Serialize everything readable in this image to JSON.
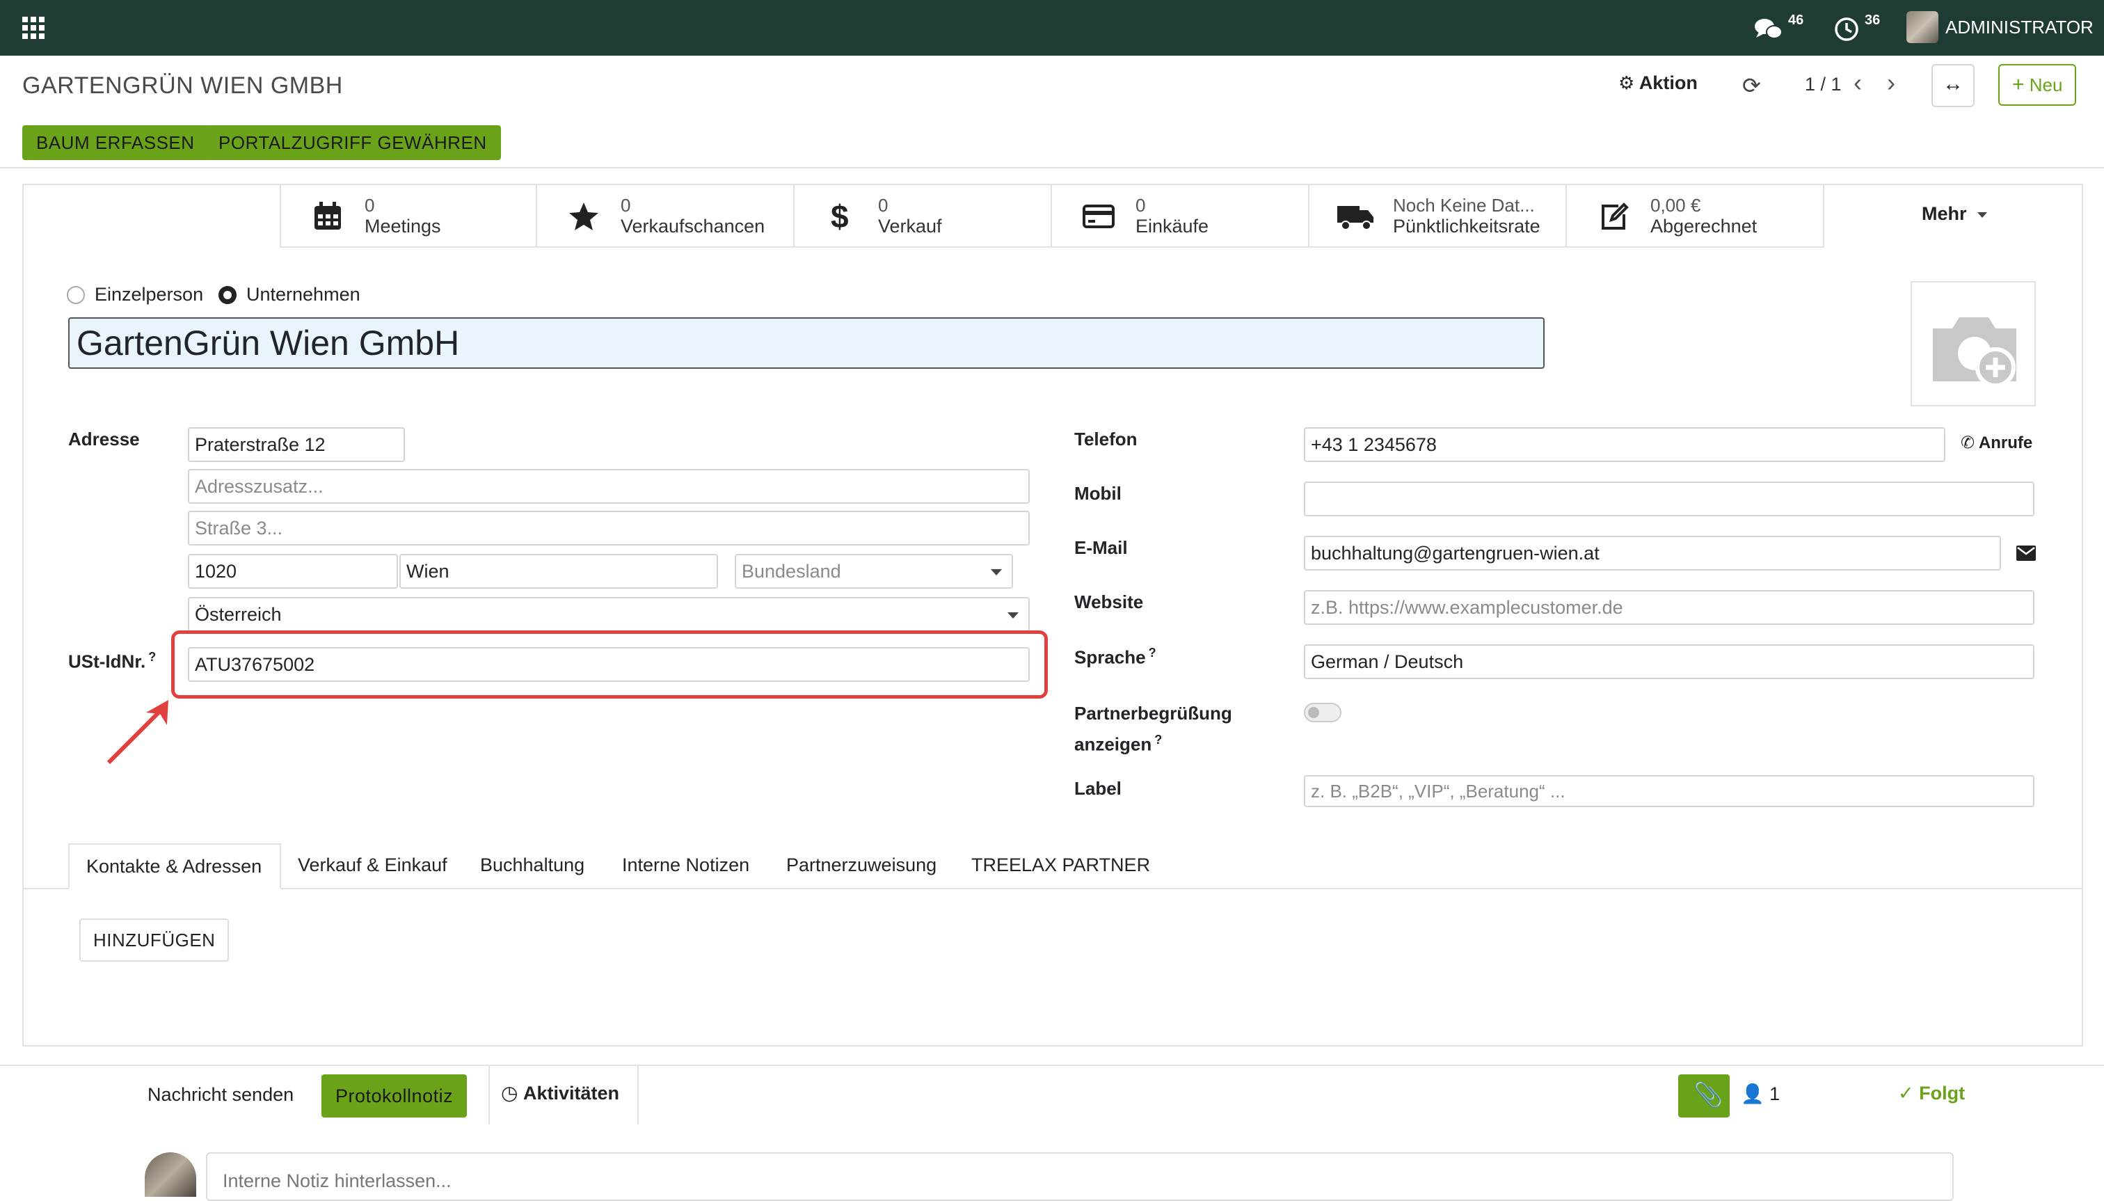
{
  "topbar": {
    "messages_count": "46",
    "activities_count": "36",
    "user_name": "ADMINISTRATOR",
    "bg_color": "#1f3b36"
  },
  "control": {
    "title": "GARTENGRÜN WIEN GMBH",
    "action_label": "Aktion",
    "pager": "1 / 1",
    "new_label": "Neu",
    "btn_tree": "BAUM ERFASSEN",
    "btn_portal": "PORTALZUGRIFF GEWÄHREN"
  },
  "stats": [
    {
      "value": "0",
      "label": "Meetings",
      "icon": "calendar-icon"
    },
    {
      "value": "0",
      "label": "Verkaufschancen",
      "icon": "star-icon"
    },
    {
      "value": "0",
      "label": "Verkauf",
      "icon": "dollar-icon"
    },
    {
      "value": "0",
      "label": "Einkäufe",
      "icon": "credit-card-icon"
    },
    {
      "value": "Noch Keine Dat...",
      "label": "Pünktlichkeitsrate",
      "icon": "truck-icon"
    },
    {
      "value": "0,00 €",
      "label": "Abgerechnet",
      "icon": "edit-icon"
    }
  ],
  "more_label": "Mehr",
  "company_type": {
    "individual": "Einzelperson",
    "company": "Unternehmen",
    "selected": "company"
  },
  "name": "GartenGrün Wien GmbH",
  "address": {
    "label": "Adresse",
    "street": "Praterstraße 12",
    "street2_placeholder": "Adresszusatz...",
    "street3_placeholder": "Straße 3...",
    "zip": "1020",
    "city": "Wien",
    "state_placeholder": "Bundesland",
    "country": "Österreich"
  },
  "vat": {
    "label": "USt-IdNr.",
    "value": "ATU37675002",
    "highlight_color": "#e0413f"
  },
  "right_fields": {
    "phone_label": "Telefon",
    "phone": "+43 1 2345678",
    "call_label": "Anrufe",
    "mobile_label": "Mobil",
    "mobile": "",
    "email_label": "E-Mail",
    "email": "buchhaltung@gartengruen-wien.at",
    "website_label": "Website",
    "website_placeholder": "z.B. https://www.examplecustomer.de",
    "language_label": "Sprache",
    "language": "German / Deutsch",
    "greeting_label_1": "Partnerbegrüßung",
    "greeting_label_2": "anzeigen",
    "tag_label": "Label",
    "tag_placeholder": "z. B. „B2B“, „VIP“, „Beratung“ ..."
  },
  "tabs": [
    "Kontakte & Adressen",
    "Verkauf & Einkauf",
    "Buchhaltung",
    "Interne Notizen",
    "Partnerzuweisung",
    "TREELAX PARTNER"
  ],
  "add_button": "HINZUFÜGEN",
  "chatter": {
    "send_message": "Nachricht senden",
    "log_note": "Protokollnotiz",
    "activities": "Aktivitäten",
    "followers_count": "1",
    "following": "Folgt",
    "note_placeholder": "Interne Notiz hinterlassen..."
  },
  "accent_color": "#6aa31a"
}
